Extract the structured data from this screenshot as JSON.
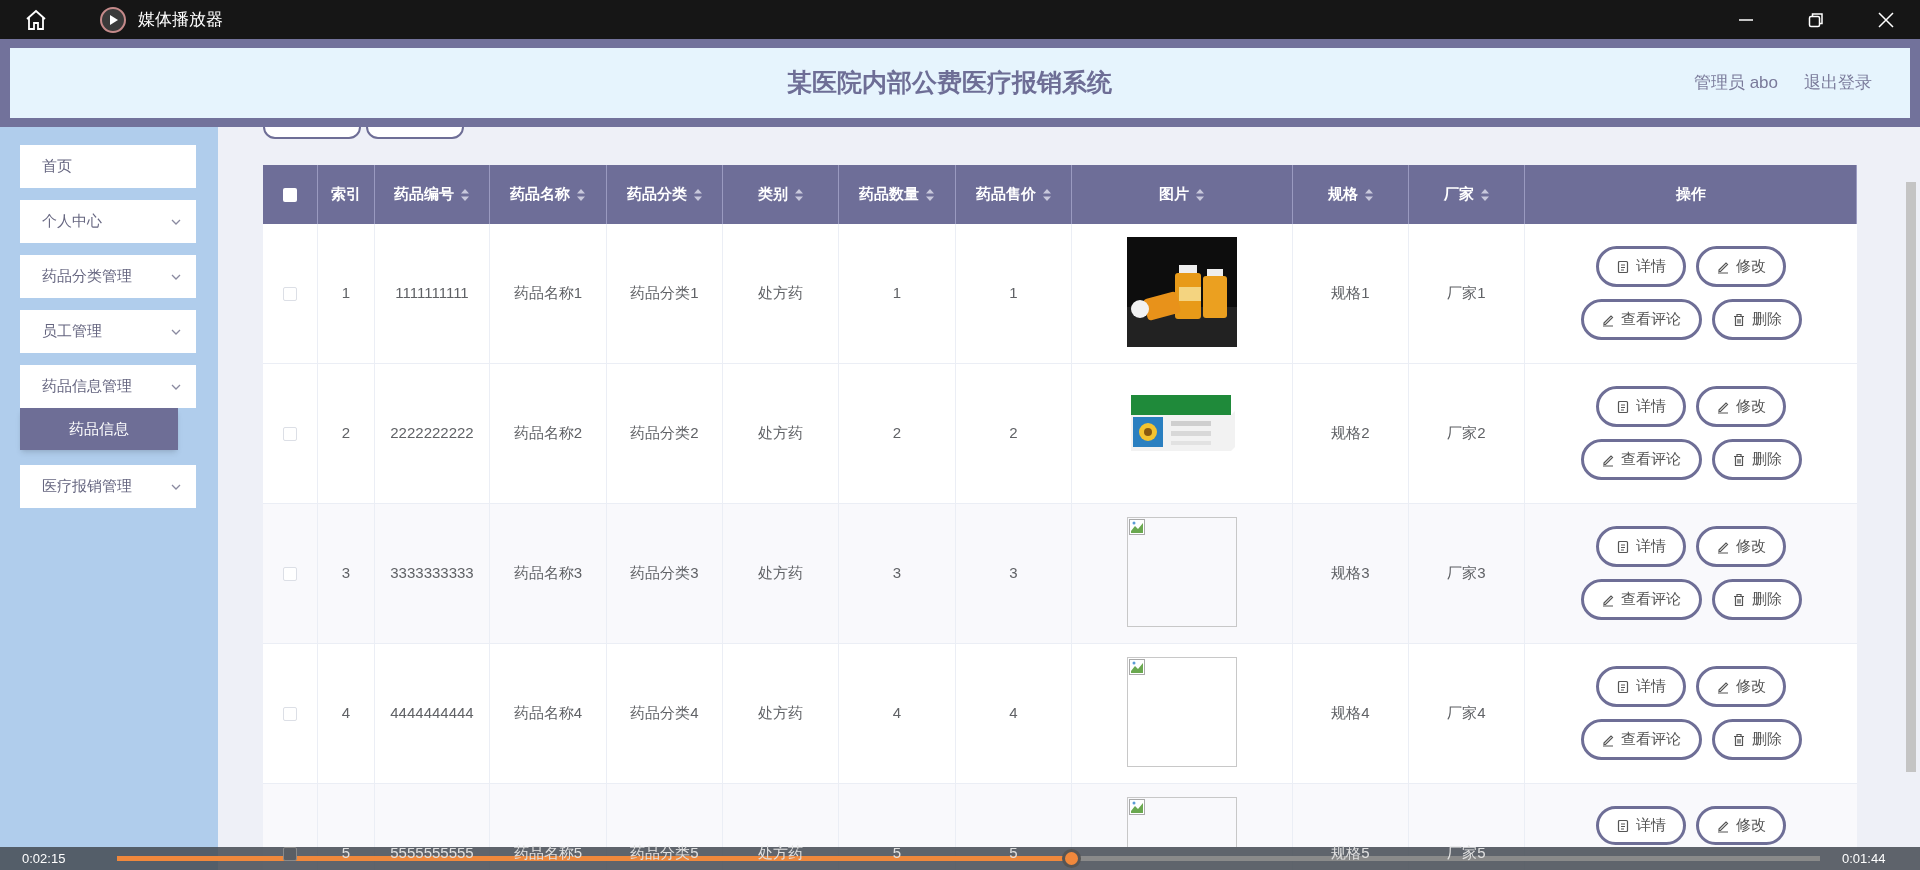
{
  "window": {
    "title": "媒体播放器"
  },
  "header": {
    "title": "某医院内部公费医疗报销系统",
    "user": "管理员 abo",
    "logout": "退出登录"
  },
  "sidebar": {
    "items": [
      {
        "label": "首页",
        "expandable": false
      },
      {
        "label": "个人中心",
        "expandable": true
      },
      {
        "label": "药品分类管理",
        "expandable": true
      },
      {
        "label": "员工管理",
        "expandable": true
      },
      {
        "label": "药品信息管理",
        "expandable": true,
        "children": [
          {
            "label": "药品信息",
            "selected": true
          }
        ]
      },
      {
        "label": "医疗报销管理",
        "expandable": true
      }
    ]
  },
  "table": {
    "select_all": {
      "checked": false
    },
    "columns": [
      {
        "label": "索引",
        "sortable": false
      },
      {
        "label": "药品编号",
        "sortable": true
      },
      {
        "label": "药品名称",
        "sortable": true
      },
      {
        "label": "药品分类",
        "sortable": true
      },
      {
        "label": "类别",
        "sortable": true
      },
      {
        "label": "药品数量",
        "sortable": true
      },
      {
        "label": "药品售价",
        "sortable": true
      },
      {
        "label": "图片",
        "sortable": true
      },
      {
        "label": "规格",
        "sortable": true
      },
      {
        "label": "厂家",
        "sortable": true
      },
      {
        "label": "操作",
        "sortable": false
      }
    ],
    "rows": [
      {
        "checked": false,
        "cells": [
          "1",
          "1111111111",
          "药品名称1",
          "药品分类1",
          "处方药",
          "1",
          "1"
        ],
        "image": {
          "kind": "picture"
        },
        "cells_after": [
          "规格1",
          "厂家1"
        ],
        "actions": [
          {
            "kind": "details",
            "label": "详情"
          },
          {
            "kind": "edit",
            "label": "修改"
          },
          {
            "kind": "comments",
            "label": "查看评论"
          },
          {
            "kind": "delete",
            "label": "删除"
          }
        ]
      },
      {
        "checked": false,
        "cells": [
          "2",
          "2222222222",
          "药品名称2",
          "药品分类2",
          "处方药",
          "2",
          "2"
        ],
        "image": {
          "kind": "picture"
        },
        "cells_after": [
          "规格2",
          "厂家2"
        ],
        "actions": [
          {
            "kind": "details",
            "label": "详情"
          },
          {
            "kind": "edit",
            "label": "修改"
          },
          {
            "kind": "comments",
            "label": "查看评论"
          },
          {
            "kind": "delete",
            "label": "删除"
          }
        ]
      },
      {
        "checked": false,
        "cells": [
          "3",
          "3333333333",
          "药品名称3",
          "药品分类3",
          "处方药",
          "3",
          "3"
        ],
        "image": {
          "kind": "broken"
        },
        "cells_after": [
          "规格3",
          "厂家3"
        ],
        "actions": [
          {
            "kind": "details",
            "label": "详情"
          },
          {
            "kind": "edit",
            "label": "修改"
          },
          {
            "kind": "comments",
            "label": "查看评论"
          },
          {
            "kind": "delete",
            "label": "删除"
          }
        ]
      },
      {
        "checked": false,
        "cells": [
          "4",
          "4444444444",
          "药品名称4",
          "药品分类4",
          "处方药",
          "4",
          "4"
        ],
        "image": {
          "kind": "broken"
        },
        "cells_after": [
          "规格4",
          "厂家4"
        ],
        "actions": [
          {
            "kind": "details",
            "label": "详情"
          },
          {
            "kind": "edit",
            "label": "修改"
          },
          {
            "kind": "comments",
            "label": "查看评论"
          },
          {
            "kind": "delete",
            "label": "删除"
          }
        ]
      },
      {
        "checked": false,
        "cells": [
          "5",
          "5555555555",
          "药品名称5",
          "药品分类5",
          "处方药",
          "5",
          "5"
        ],
        "image": {
          "kind": "broken"
        },
        "cells_after": [
          "规格5",
          "厂家5"
        ],
        "actions": [
          {
            "kind": "details",
            "label": "详情"
          },
          {
            "kind": "edit",
            "label": "修改"
          }
        ]
      }
    ]
  },
  "player": {
    "elapsed": "0:02:15",
    "remaining": "0:01:44",
    "level": 0.56
  }
}
